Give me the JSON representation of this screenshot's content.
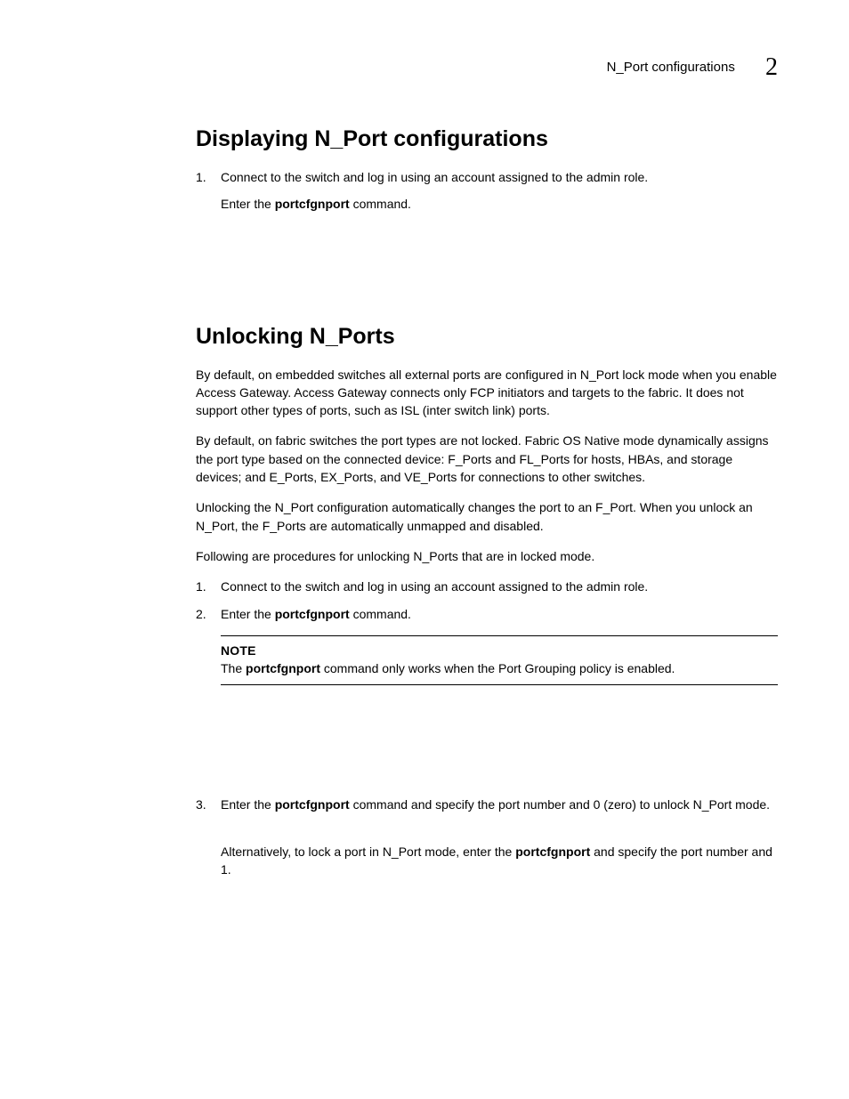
{
  "header": {
    "running_title": "N_Port configurations",
    "chapter_number": "2"
  },
  "sections": {
    "displaying": {
      "title": "Displaying N_Port configurations",
      "steps": [
        {
          "num": "1.",
          "text": "Connect to the switch and log in using an account assigned to the admin role.",
          "sub_pre": "Enter the ",
          "sub_cmd": "portcfgnport",
          "sub_post": " command."
        }
      ]
    },
    "unlocking": {
      "title": "Unlocking N_Ports",
      "paras": [
        "By default, on embedded switches all external ports are configured in N_Port lock mode when you enable Access Gateway. Access Gateway connects only FCP initiators and targets to the fabric. It does not support other types of ports, such as ISL (inter switch link) ports.",
        "By default, on fabric switches the port types are not locked. Fabric OS Native mode dynamically assigns the port type based on the connected device: F_Ports and FL_Ports for hosts, HBAs, and storage devices; and E_Ports, EX_Ports, and VE_Ports for connections to other switches.",
        "Unlocking the N_Port configuration automatically changes the port to an F_Port. When you unlock an N_Port, the F_Ports are automatically unmapped and disabled.",
        "Following are procedures for unlocking N_Ports that are in locked mode."
      ],
      "steps12": [
        {
          "num": "1.",
          "text": "Connect to the switch and log in using an account assigned to the admin role."
        },
        {
          "num": "2.",
          "pre": "Enter the ",
          "cmd": "portcfgnport",
          "post": " command."
        }
      ],
      "note": {
        "label": "NOTE",
        "pre": "The ",
        "cmd": "portcfgnport",
        "post": " command only works when the Port Grouping policy is enabled."
      },
      "step3": {
        "num": "3.",
        "pre": "Enter the ",
        "cmd": "portcfgnport",
        "post": " command and specify the port number and 0 (zero) to unlock N_Port mode.",
        "alt_pre": "Alternatively, to lock a port in N_Port mode, enter the ",
        "alt_cmd": "portcfgnport",
        "alt_post": " and specify the port number and 1."
      }
    }
  }
}
